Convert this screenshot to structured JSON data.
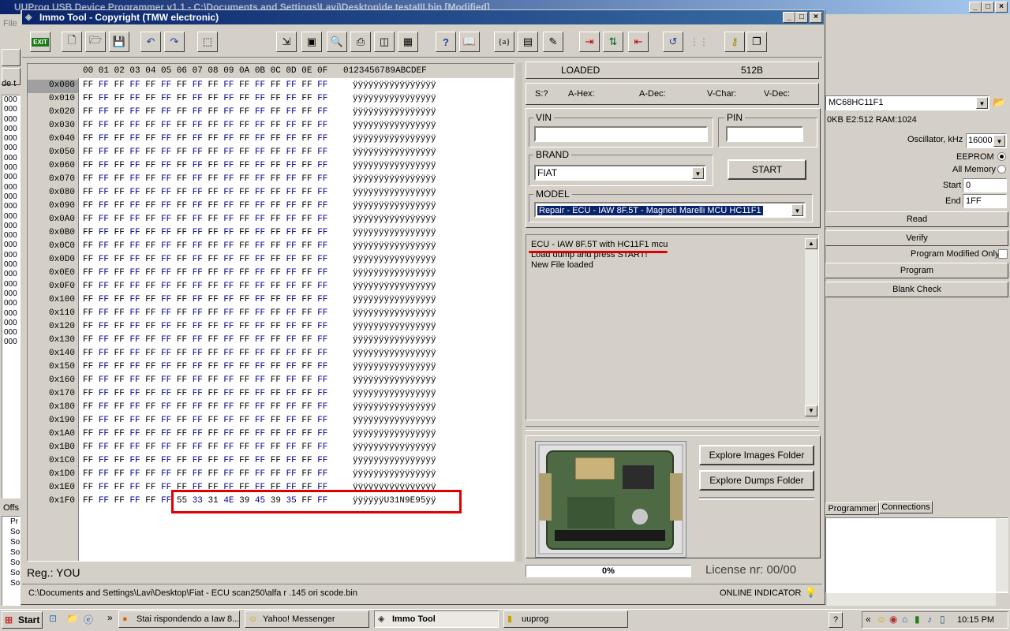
{
  "background_app": {
    "title": "UUProg USB Device Programmer v1.1 - C:\\Documents and Settings\\Lavi\\Desktop\\de testaIII.bin [Modified]",
    "menu_file": "File",
    "tab_partial": "de t",
    "offs_label": "Offs",
    "device_select": "MC68HC11F1",
    "device_info": "0KB E2:512 RAM:1024",
    "oscillator_label": "Oscillator, kHz",
    "oscillator_value": "16000",
    "eeprom_label": "EEPROM",
    "all_memory_label": "All Memory",
    "start_label": "Start",
    "start_value": "0",
    "end_label": "End",
    "end_value": "1FF",
    "read_button": "Read",
    "verify_button": "Verify",
    "program_modified_only": "Program Modified Only",
    "program_button": "Program",
    "blank_check_button": "Blank Check",
    "tab_programmer": "Programmer",
    "tab_connections": "Connections",
    "left_list_partial": [
      "000",
      "000",
      "000",
      "000",
      "000",
      "000",
      "000",
      "000",
      "000",
      "000",
      "000",
      "000",
      "000",
      "000",
      "000",
      "000",
      "000",
      "000",
      "000",
      "000",
      "000",
      "000",
      "000",
      "000",
      "000",
      "000"
    ],
    "left_log_partial": [
      "Pr",
      "So",
      "So",
      "So",
      "So",
      "So",
      "So"
    ]
  },
  "window": {
    "title": "Immo Tool - Copyright (TMW electronic)"
  },
  "toolbar": {
    "exit_label": "EXIT",
    "help_label": "?",
    "var_label": "{a}"
  },
  "hex": {
    "header": "00 01 02 03 04 05 06 07 08 09 0A 0B 0C 0D 0E 0F   0123456789ABCDEF",
    "rows": [
      {
        "addr": "0x000",
        "ascii": "ÿÿÿÿÿÿÿÿÿÿÿÿÿÿÿÿ"
      },
      {
        "addr": "0x010",
        "ascii": "ÿÿÿÿÿÿÿÿÿÿÿÿÿÿÿÿ"
      },
      {
        "addr": "0x020",
        "ascii": "ÿÿÿÿÿÿÿÿÿÿÿÿÿÿÿÿ"
      },
      {
        "addr": "0x030",
        "ascii": "ÿÿÿÿÿÿÿÿÿÿÿÿÿÿÿÿ"
      },
      {
        "addr": "0x040",
        "ascii": "ÿÿÿÿÿÿÿÿÿÿÿÿÿÿÿÿ"
      },
      {
        "addr": "0x050",
        "ascii": "ÿÿÿÿÿÿÿÿÿÿÿÿÿÿÿÿ"
      },
      {
        "addr": "0x060",
        "ascii": "ÿÿÿÿÿÿÿÿÿÿÿÿÿÿÿÿ"
      },
      {
        "addr": "0x070",
        "ascii": "ÿÿÿÿÿÿÿÿÿÿÿÿÿÿÿÿ"
      },
      {
        "addr": "0x080",
        "ascii": "ÿÿÿÿÿÿÿÿÿÿÿÿÿÿÿÿ"
      },
      {
        "addr": "0x090",
        "ascii": "ÿÿÿÿÿÿÿÿÿÿÿÿÿÿÿÿ"
      },
      {
        "addr": "0x0A0",
        "ascii": "ÿÿÿÿÿÿÿÿÿÿÿÿÿÿÿÿ"
      },
      {
        "addr": "0x0B0",
        "ascii": "ÿÿÿÿÿÿÿÿÿÿÿÿÿÿÿÿ"
      },
      {
        "addr": "0x0C0",
        "ascii": "ÿÿÿÿÿÿÿÿÿÿÿÿÿÿÿÿ"
      },
      {
        "addr": "0x0D0",
        "ascii": "ÿÿÿÿÿÿÿÿÿÿÿÿÿÿÿÿ"
      },
      {
        "addr": "0x0E0",
        "ascii": "ÿÿÿÿÿÿÿÿÿÿÿÿÿÿÿÿ"
      },
      {
        "addr": "0x0F0",
        "ascii": "ÿÿÿÿÿÿÿÿÿÿÿÿÿÿÿÿ"
      },
      {
        "addr": "0x100",
        "ascii": "ÿÿÿÿÿÿÿÿÿÿÿÿÿÿÿÿ"
      },
      {
        "addr": "0x110",
        "ascii": "ÿÿÿÿÿÿÿÿÿÿÿÿÿÿÿÿ"
      },
      {
        "addr": "0x120",
        "ascii": "ÿÿÿÿÿÿÿÿÿÿÿÿÿÿÿÿ"
      },
      {
        "addr": "0x130",
        "ascii": "ÿÿÿÿÿÿÿÿÿÿÿÿÿÿÿÿ"
      },
      {
        "addr": "0x140",
        "ascii": "ÿÿÿÿÿÿÿÿÿÿÿÿÿÿÿÿ"
      },
      {
        "addr": "0x150",
        "ascii": "ÿÿÿÿÿÿÿÿÿÿÿÿÿÿÿÿ"
      },
      {
        "addr": "0x160",
        "ascii": "ÿÿÿÿÿÿÿÿÿÿÿÿÿÿÿÿ"
      },
      {
        "addr": "0x170",
        "ascii": "ÿÿÿÿÿÿÿÿÿÿÿÿÿÿÿÿ"
      },
      {
        "addr": "0x180",
        "ascii": "ÿÿÿÿÿÿÿÿÿÿÿÿÿÿÿÿ"
      },
      {
        "addr": "0x190",
        "ascii": "ÿÿÿÿÿÿÿÿÿÿÿÿÿÿÿÿ"
      },
      {
        "addr": "0x1A0",
        "ascii": "ÿÿÿÿÿÿÿÿÿÿÿÿÿÿÿÿ"
      },
      {
        "addr": "0x1B0",
        "ascii": "ÿÿÿÿÿÿÿÿÿÿÿÿÿÿÿÿ"
      },
      {
        "addr": "0x1C0",
        "ascii": "ÿÿÿÿÿÿÿÿÿÿÿÿÿÿÿÿ"
      },
      {
        "addr": "0x1D0",
        "ascii": "ÿÿÿÿÿÿÿÿÿÿÿÿÿÿÿÿ"
      },
      {
        "addr": "0x1E0",
        "ascii": "ÿÿÿÿÿÿÿÿÿÿÿÿÿÿÿÿ"
      },
      {
        "addr": "0x1F0",
        "ascii": "ÿÿÿÿÿÿU31N9E95ÿÿ"
      }
    ],
    "ff": "FF",
    "last_row_bytes": [
      "FF",
      "FF",
      "FF",
      "FF",
      "FF",
      "FF",
      "55",
      "33",
      "31",
      "4E",
      "39",
      "45",
      "39",
      "35",
      "FF",
      "FF"
    ],
    "reg_label": "Reg.: YOU"
  },
  "status_top": {
    "loaded": "LOADED",
    "size": "512B"
  },
  "fields_row": {
    "s": "S:?",
    "a_hex": "A-Hex:",
    "a_dec": "A-Dec:",
    "v_char": "V-Char:",
    "v_dec": "V-Dec:"
  },
  "form": {
    "vin_label": "VIN",
    "vin_value": "",
    "pin_label": "PIN",
    "pin_value": "",
    "brand_label": "BRAND",
    "brand_value": "FIAT",
    "start_button": "START",
    "model_label": "MODEL",
    "model_value": "Repair - ECU - IAW 8F.5T - Magneti Marelli MCU HC11F1"
  },
  "log": {
    "lines": [
      "ECU - IAW 8F.5T with HC11F1 mcu",
      "Load dump and press START!",
      "New File loaded"
    ]
  },
  "image_panel": {
    "explore_images": "Explore Images Folder",
    "explore_dumps": "Explore Dumps Folder"
  },
  "bottom": {
    "progress_text": "0%",
    "progress_value": 0,
    "license": "License nr: 00/00",
    "path": "C:\\Documents and Settings\\Lavi\\Desktop\\Fiat - ECU scan250\\alfa r .145 ori scode.bin",
    "online": "ONLINE INDICATOR"
  },
  "taskbar": {
    "start": "Start",
    "chevron": "»",
    "tasks": [
      "Stai rispondendo a Iaw 8...",
      "Yahoo! Messenger",
      "Immo Tool",
      "uuprog"
    ],
    "tray_chevron": "«",
    "clock": "10:15 PM",
    "help": "?"
  },
  "colors": {
    "titlebar": "#0a246a",
    "highlight": "#e00000",
    "hex_blue": "#00008b",
    "face": "#d4d0c8"
  }
}
